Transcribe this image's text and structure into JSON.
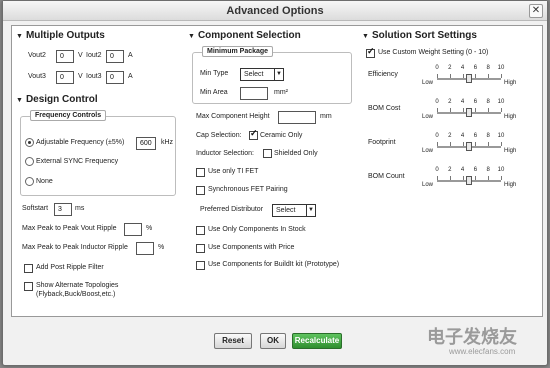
{
  "dialog": {
    "title": "Advanced Options",
    "close": "✕"
  },
  "outputs": {
    "title": "Multiple Outputs",
    "rows": [
      {
        "vlabel": "Vout2",
        "vvalue": "0",
        "vunit": "V",
        "ilabel": "Iout2",
        "ivalue": "0",
        "iunit": "A"
      },
      {
        "vlabel": "Vout3",
        "vvalue": "0",
        "vunit": "V",
        "ilabel": "Iout3",
        "ivalue": "0",
        "iunit": "A"
      }
    ]
  },
  "design": {
    "title": "Design Control",
    "frequency_title": "Frequency Controls",
    "adjustable_label": "Adjustable Frequency (±5%)",
    "adjustable_value": "600",
    "adjustable_unit": "kHz",
    "external_label": "External SYNC Frequency",
    "none_label": "None",
    "softstart_label": "Softstart",
    "softstart_value": "3",
    "softstart_unit": "ms",
    "vout_ripple_label": "Max Peak to Peak Vout Ripple",
    "vout_ripple_unit": "%",
    "inductor_ripple_label": "Max Peak to Peak Inductor Ripple",
    "inductor_ripple_unit": "%",
    "post_filter_label": "Add Post Ripple Filter",
    "alt_topologies_label": "Show Alternate Topologies",
    "alt_topologies_sub": "(Flyback,Buck/Boost,etc.)"
  },
  "component": {
    "title": "Component Selection",
    "min_package_title": "Minimum Package",
    "min_type_label": "Min Type",
    "min_type_value": "Select",
    "min_area_label": "Min Area",
    "min_area_unit": "mm²",
    "max_height_label": "Max Component Height",
    "max_height_unit": "mm",
    "cap_label": "Cap Selection:",
    "cap_option": "Ceramic Only",
    "inductor_label": "Inductor Selection:",
    "inductor_option": "Shielded Only",
    "ti_fet_label": "Use only TI FET",
    "sync_fet_label": "Synchronous FET Pairing",
    "distributor_label": "Preferred Distributor",
    "distributor_value": "Select",
    "stock_label": "Use Only Components In Stock",
    "price_label": "Use Components with Price",
    "buildit_label": "Use Components for BuildIt kit (Prototype)"
  },
  "sort": {
    "title": "Solution Sort Settings",
    "custom_weight_label": "Use Custom Weight Setting (0 - 10)",
    "tick_labels": [
      "0",
      "2",
      "4",
      "6",
      "8",
      "10"
    ],
    "low_label": "Low",
    "high_label": "High",
    "sliders": [
      {
        "label": "Efficiency",
        "value": 5
      },
      {
        "label": "BOM Cost",
        "value": 5
      },
      {
        "label": "Footprint",
        "value": 5
      },
      {
        "label": "BOM Count",
        "value": 5
      }
    ]
  },
  "buttons": {
    "reset": "Reset",
    "ok": "OK",
    "recalculate": "Recalculate"
  },
  "watermark": {
    "logo": "电子发烧友",
    "url": "www.elecfans.com"
  }
}
